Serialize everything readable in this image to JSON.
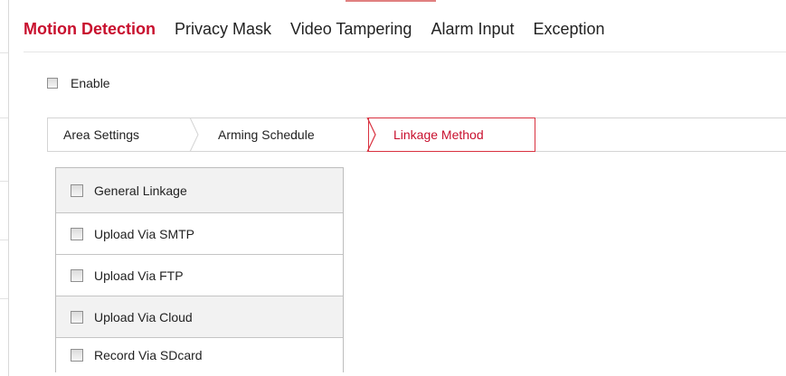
{
  "main_tabs": [
    {
      "label": "Motion Detection",
      "active": true
    },
    {
      "label": "Privacy Mask",
      "active": false
    },
    {
      "label": "Video Tampering",
      "active": false
    },
    {
      "label": "Alarm Input",
      "active": false
    },
    {
      "label": "Exception",
      "active": false
    }
  ],
  "enable": {
    "label": "Enable",
    "checked": false
  },
  "sub_tabs": [
    {
      "label": "Area Settings",
      "active": false
    },
    {
      "label": "Arming Schedule",
      "active": false
    },
    {
      "label": "Linkage Method",
      "active": true
    }
  ],
  "linkage_items": [
    {
      "label": "General Linkage",
      "checked": false
    },
    {
      "label": "Upload Via SMTP",
      "checked": false
    },
    {
      "label": "Upload Via FTP",
      "checked": false
    },
    {
      "label": "Upload Via Cloud",
      "checked": false
    },
    {
      "label": "Record Via SDcard",
      "checked": false
    }
  ],
  "colors": {
    "accent": "#c8102e",
    "active_border": "#d9313f",
    "row_alt_bg": "#f2f2f2",
    "divider": "#d4d4d4"
  }
}
